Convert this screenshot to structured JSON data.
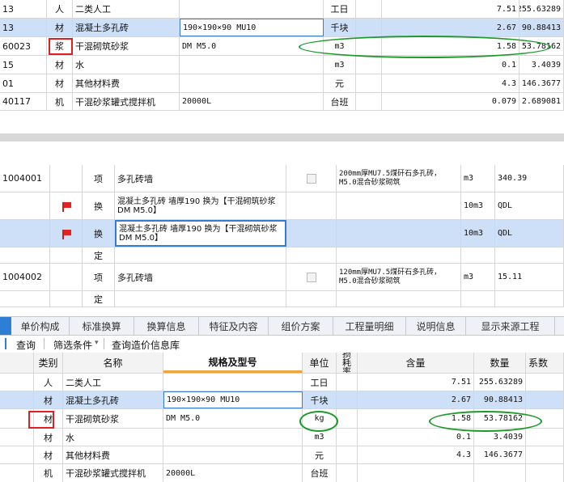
{
  "top_grid": {
    "rows": [
      {
        "code": "13",
        "cat": "人",
        "name": "二类人工",
        "spec": "",
        "unit": "工日",
        "qty": "7.51",
        "amount": "255.63289"
      },
      {
        "code": "13",
        "cat": "材",
        "name": "混凝土多孔砖",
        "spec": "190×190×90 MU10",
        "unit": "千块",
        "qty": "2.67",
        "amount": "90.88413"
      },
      {
        "code": "60023",
        "cat": "浆",
        "name": "干混砌筑砂浆",
        "spec": "DM M5.0",
        "unit": "m3",
        "qty": "1.58",
        "amount": "53.78162"
      },
      {
        "code": "15",
        "cat": "材",
        "name": "水",
        "spec": "",
        "unit": "m3",
        "qty": "0.1",
        "amount": "3.4039"
      },
      {
        "code": "01",
        "cat": "材",
        "name": "其他材料费",
        "spec": "",
        "unit": "元",
        "qty": "4.3",
        "amount": "146.3677"
      },
      {
        "code": "40117",
        "cat": "机",
        "name": "干混砂浆罐式搅拌机",
        "spec": "20000L",
        "unit": "台班",
        "qty": "0.079",
        "amount": "2.689081"
      }
    ]
  },
  "middle_grid": {
    "rows": [
      {
        "code": "1004001",
        "type": "项",
        "name": "多孔砖墙",
        "feature": "200mm厚MU7.5煤矸石多孔砖，M5.0混合砂浆砌筑",
        "unit": "m3",
        "value": "340.39",
        "flag": false,
        "check": true
      },
      {
        "code": "",
        "type": "换",
        "name": "混凝土多孔砖 墙厚190  换为【干混砌筑砂浆 DM M5.0】",
        "feature": "",
        "unit": "10m3",
        "value": "QDL",
        "flag": true,
        "check": false
      },
      {
        "code": "",
        "type": "换",
        "name": "混凝土多孔砖 墙厚190  换为【干混砌筑砂浆 DM M5.0】",
        "feature": "",
        "unit": "10m3",
        "value": "QDL",
        "flag": true,
        "check": false
      },
      {
        "code": "",
        "type": "定",
        "name": "",
        "feature": "",
        "unit": "",
        "value": "",
        "flag": false,
        "check": false
      },
      {
        "code": "1004002",
        "type": "项",
        "name": "多孔砖墙",
        "feature": "120mm厚MU7.5煤矸石多孔砖，M5.0混合砂浆砌筑",
        "unit": "m3",
        "value": "15.11",
        "flag": false,
        "check": true
      },
      {
        "code": "",
        "type": "定",
        "name": "",
        "feature": "",
        "unit": "",
        "value": "",
        "flag": false,
        "check": false
      }
    ]
  },
  "tabs": [
    "单价构成",
    "标准换算",
    "换算信息",
    "特征及内容",
    "组价方案",
    "工程量明细",
    "说明信息",
    "显示来源工程"
  ],
  "toolbar": {
    "query": "查询",
    "filter": "筛选条件",
    "filter_arrow": "▾",
    "lookup": "查询造价信息库"
  },
  "bottom_grid": {
    "headers": {
      "cat": "类别",
      "name": "名称",
      "spec": "规格及型号",
      "unit": "单位",
      "loss": "损耗率",
      "content": "含量",
      "qty": "数量",
      "coef": "系数"
    },
    "rows": [
      {
        "cat": "人",
        "name": "二类人工",
        "spec": "",
        "unit": "工日",
        "content": "7.51",
        "qty": "255.63289"
      },
      {
        "cat": "材",
        "name": "混凝土多孔砖",
        "spec": "190×190×90 MU10",
        "unit": "千块",
        "content": "2.67",
        "qty": "90.88413"
      },
      {
        "cat": "材",
        "name": "干混砌筑砂浆",
        "spec": "DM M5.0",
        "unit": "kg",
        "content": "1.58",
        "qty": "53.78162"
      },
      {
        "cat": "材",
        "name": "水",
        "spec": "",
        "unit": "m3",
        "content": "0.1",
        "qty": "3.4039"
      },
      {
        "cat": "材",
        "name": "其他材料费",
        "spec": "",
        "unit": "元",
        "content": "4.3",
        "qty": "146.3677"
      },
      {
        "cat": "机",
        "name": "干混砂浆罐式搅拌机",
        "spec": "20000L",
        "unit": "台班",
        "content": "",
        "qty": ""
      }
    ]
  }
}
